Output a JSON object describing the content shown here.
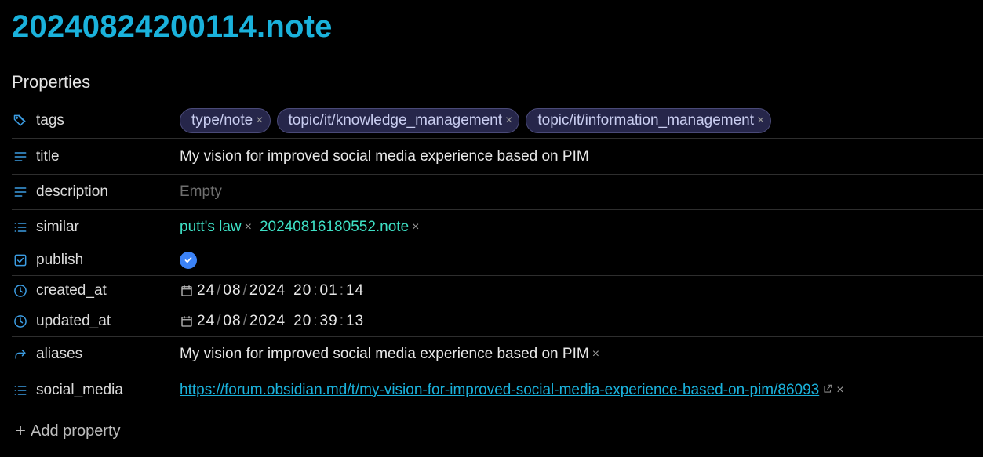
{
  "note": {
    "title": "20240824200114.note"
  },
  "properties_heading": "Properties",
  "properties": {
    "tags": {
      "key": "tags",
      "values": [
        "type/note",
        "topic/it/knowledge_management",
        "topic/it/information_management"
      ]
    },
    "title": {
      "key": "title",
      "value": "My vision for improved social media experience based on PIM"
    },
    "description": {
      "key": "description",
      "placeholder": "Empty"
    },
    "similar": {
      "key": "similar",
      "values": [
        "putt's law",
        "20240816180552.note"
      ]
    },
    "publish": {
      "key": "publish",
      "checked": true
    },
    "created_at": {
      "key": "created_at",
      "day": "24",
      "month": "08",
      "year": "2024",
      "hour": "20",
      "minute": "01",
      "second": "14"
    },
    "updated_at": {
      "key": "updated_at",
      "day": "24",
      "month": "08",
      "year": "2024",
      "hour": "20",
      "minute": "39",
      "second": "13"
    },
    "aliases": {
      "key": "aliases",
      "values": [
        "My vision for improved social media experience based on PIM"
      ]
    },
    "social_media": {
      "key": "social_media",
      "values": [
        "https://forum.obsidian.md/t/my-vision-for-improved-social-media-experience-based-on-pim/86093"
      ]
    }
  },
  "add_property_label": "Add property",
  "remove_symbol": "×",
  "date_sep": "/",
  "time_sep": ":",
  "colors": {
    "title": "#1ab2dc",
    "icon": "#3c9de3",
    "internal_link": "#3ee0c5",
    "tag_bg": "#26264a"
  }
}
